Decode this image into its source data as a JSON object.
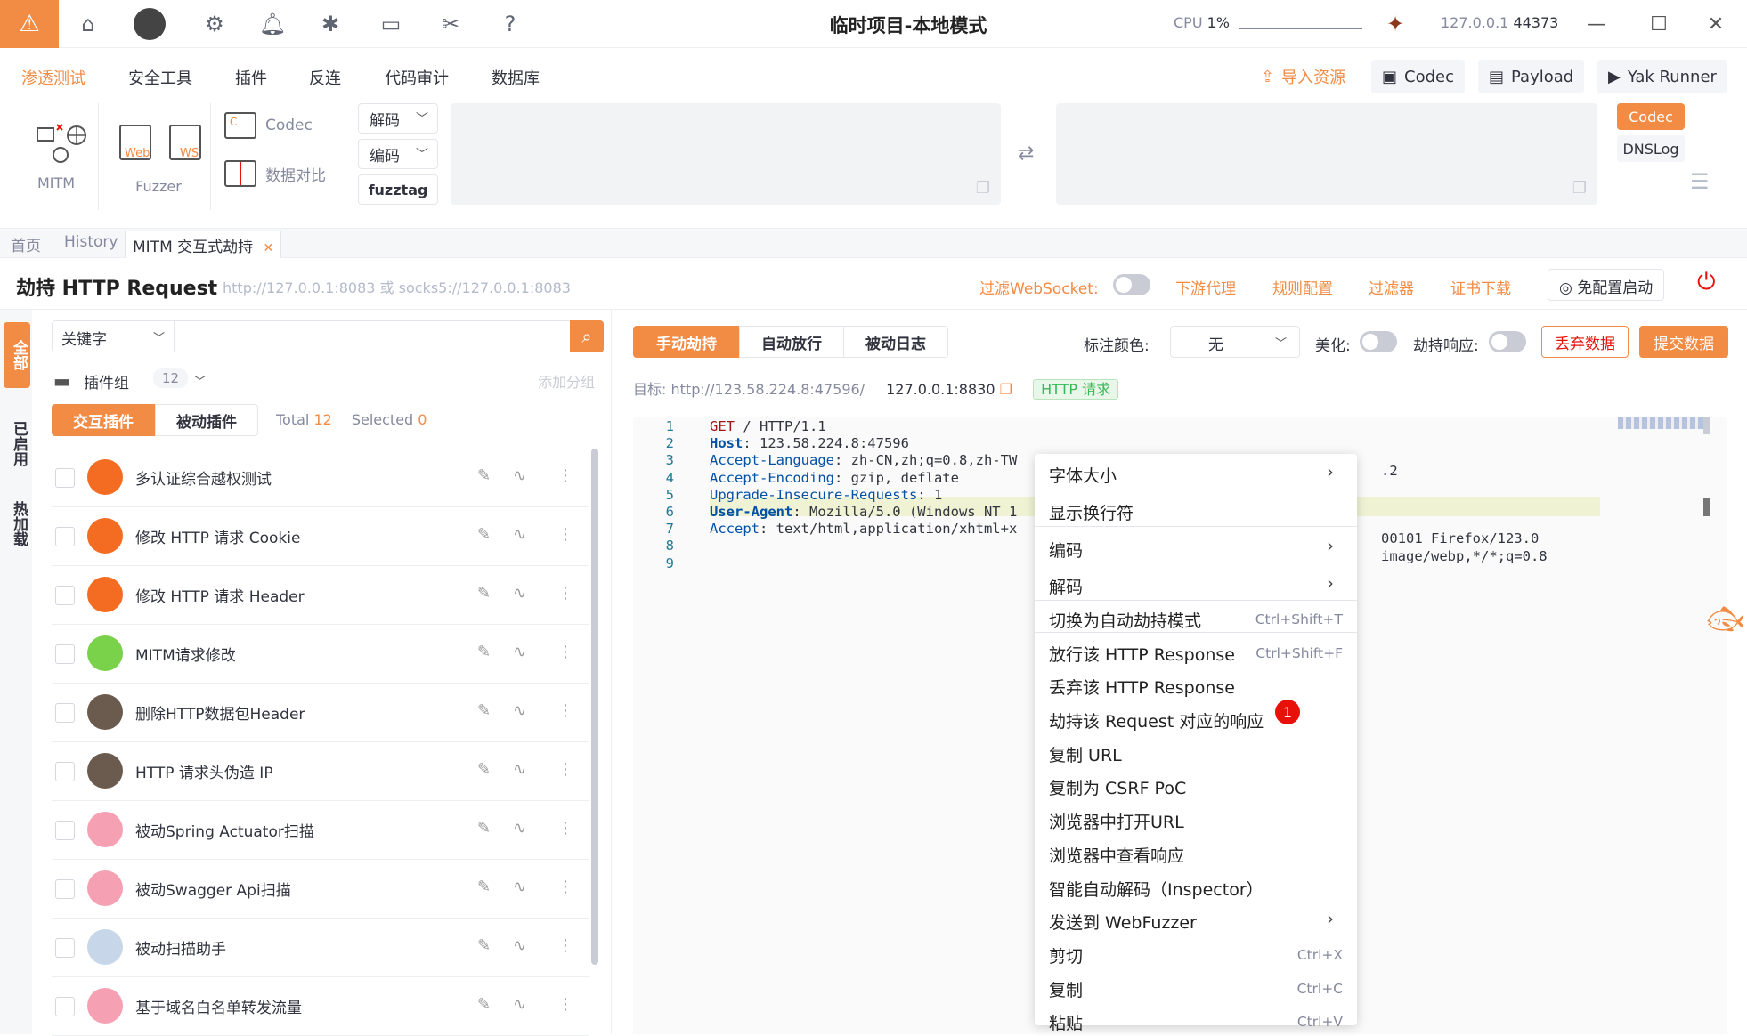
{
  "titlebar": {
    "title": "临时项目-本地模式",
    "cpu_label": "CPU",
    "cpu_value": "1%",
    "host": "127.0.0.1",
    "port": "44373"
  },
  "menubar": {
    "items": [
      "渗透测试",
      "安全工具",
      "插件",
      "反连",
      "代码审计",
      "数据库"
    ],
    "import": "导入资源",
    "codec": "Codec",
    "payload": "Payload",
    "runner": "Yak Runner"
  },
  "toolbar": {
    "mitm": "MITM",
    "fuzzer": "Fuzzer",
    "web": "Web",
    "ws": "WS",
    "codec": "Codec",
    "diff": "数据对比",
    "decode": "解码",
    "encode": "编码",
    "fuzztag": "fuzztag",
    "codec_btn": "Codec",
    "dnslog_btn": "DNSLog"
  },
  "tabs": {
    "home": "首页",
    "history": "History",
    "mitm": "MITM 交互式劫持",
    "close": "✕"
  },
  "header": {
    "title": "劫持 HTTP Request",
    "subtitle": "http://127.0.0.1:8083 或 socks5://127.0.0.1:8083",
    "ws_label": "过滤WebSocket:",
    "downstream": "下游代理",
    "rules": "规则配置",
    "filter": "过滤器",
    "cert": "证书下载",
    "noconfig": "免配置启动"
  },
  "leftstrip": {
    "all": "全部",
    "enabled": "已启用",
    "hot": "热加载"
  },
  "left": {
    "search_select": "关键字",
    "plugin_group": "插件组",
    "group_count": "12",
    "add_group": "添加分组",
    "tab_interactive": "交互插件",
    "tab_passive": "被动插件",
    "total_label": "Total",
    "total": "12",
    "selected_label": "Selected",
    "selected": "0",
    "plugins": [
      {
        "name": "多认证综合越权测试",
        "avatar": "#f36c21"
      },
      {
        "name": "修改 HTTP 请求 Cookie",
        "avatar": "#f36c21"
      },
      {
        "name": "修改 HTTP 请求 Header",
        "avatar": "#f36c21"
      },
      {
        "name": "MITM请求修改",
        "avatar": "#7ad14a"
      },
      {
        "name": "删除HTTP数据包Header",
        "avatar": "#6b5a4e"
      },
      {
        "name": "HTTP 请求头伪造 IP",
        "avatar": "#6b5a4e"
      },
      {
        "name": "被动Spring Actuator扫描",
        "avatar": "#f6a1b3"
      },
      {
        "name": "被动Swagger Api扫描",
        "avatar": "#f6a1b3"
      },
      {
        "name": "被动扫描助手",
        "avatar": "#c7d6e8"
      },
      {
        "name": "基于域名白名单转发流量",
        "avatar": "#f6a1b3"
      }
    ]
  },
  "right": {
    "tab_manual": "手动劫持",
    "tab_auto": "自动放行",
    "tab_log": "被动日志",
    "color_label": "标注颜色:",
    "color_value": "无",
    "beautify": "美化:",
    "hijack_resp": "劫持响应:",
    "discard": "丢弃数据",
    "submit": "提交数据",
    "target_label": "目标:",
    "target_url": "http://123.58.224.8:47596/",
    "local": "127.0.0.1:8830",
    "badge": "HTTP 请求"
  },
  "code": {
    "lines": [
      {
        "n": "1",
        "k": "GET",
        "v": " / HTTP/1.1"
      },
      {
        "n": "2",
        "k": "Host",
        "v": ": 123.58.224.8:47596"
      },
      {
        "n": "3",
        "k": "Accept-Language",
        "v": ": zh-CN,zh;q=0.8,zh-TW"
      },
      {
        "n": "4",
        "k": "Accept-Encoding",
        "v": ": gzip, deflate"
      },
      {
        "n": "5",
        "k": "Upgrade-Insecure-Requests",
        "v": ": 1"
      },
      {
        "n": "6",
        "k": "User-Agent",
        "v": ": Mozilla/5.0 (Windows NT 1"
      },
      {
        "n": "7",
        "k": "Accept",
        "v": ": text/html,application/xhtml+x"
      },
      {
        "n": "8",
        "k": "",
        "v": ""
      },
      {
        "n": "9",
        "k": "",
        "v": ""
      }
    ],
    "tail3": ".2",
    "tail6": "00101 Firefox/123.0",
    "tail7": "image/webp,*/*;q=0.8"
  },
  "context_menu": {
    "items": [
      {
        "label": "字体大小",
        "key": "",
        "arrow": "›"
      },
      {
        "label": "显示换行符",
        "key": "",
        "arrow": ""
      },
      {
        "label": "编码",
        "key": "",
        "arrow": "›"
      },
      {
        "label": "解码",
        "key": "",
        "arrow": "›"
      },
      {
        "label": "切换为自动劫持模式",
        "key": "Ctrl+Shift+T",
        "arrow": ""
      },
      {
        "label": "放行该 HTTP Response",
        "key": "Ctrl+Shift+F",
        "arrow": ""
      },
      {
        "label": "丢弃该 HTTP Response",
        "key": "",
        "arrow": ""
      },
      {
        "label": "劫持该 Request 对应的响应",
        "key": "",
        "arrow": ""
      },
      {
        "label": "复制 URL",
        "key": "",
        "arrow": ""
      },
      {
        "label": "复制为 CSRF PoC",
        "key": "",
        "arrow": ""
      },
      {
        "label": "浏览器中打开URL",
        "key": "",
        "arrow": ""
      },
      {
        "label": "浏览器中查看响应",
        "key": "",
        "arrow": ""
      },
      {
        "label": "智能自动解码（Inspector）",
        "key": "",
        "arrow": ""
      },
      {
        "label": "发送到 WebFuzzer",
        "key": "",
        "arrow": "›"
      },
      {
        "label": "剪切",
        "key": "Ctrl+X",
        "arrow": ""
      },
      {
        "label": "复制",
        "key": "Ctrl+C",
        "arrow": ""
      },
      {
        "label": "粘贴",
        "key": "Ctrl+V",
        "arrow": ""
      }
    ],
    "badge": "1"
  },
  "colors": {
    "accent": "#f28b44",
    "danger": "#e8110a",
    "muted": "#85899e"
  }
}
